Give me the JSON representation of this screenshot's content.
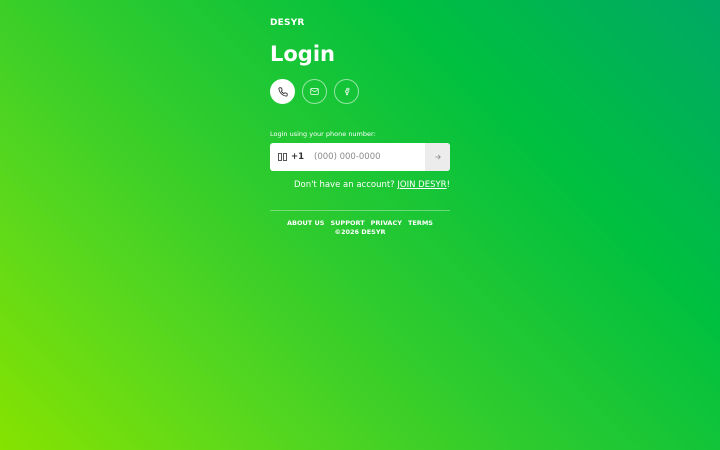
{
  "brand": {
    "logo": "DESYR"
  },
  "page": {
    "title": "Login"
  },
  "methods": [
    {
      "name": "phone",
      "icon": "phone-icon",
      "active": true
    },
    {
      "name": "email",
      "icon": "mail-icon",
      "active": false
    },
    {
      "name": "facebook",
      "icon": "facebook-icon",
      "active": false
    }
  ],
  "form": {
    "label": "Login using your phone number:",
    "country_code": "+1",
    "flag_icon": "flag-icon",
    "phone_placeholder": "(000) 000-0000",
    "phone_value": "",
    "submit_icon": "arrow-right-icon"
  },
  "signup": {
    "prompt": "Don't have an account? ",
    "link": "JOIN DESYR",
    "suffix": "!"
  },
  "footer": {
    "links": [
      "ABOUT US",
      "SUPPORT",
      "PRIVACY",
      "TERMS"
    ],
    "copyright": "©2026 DESYR"
  },
  "colors": {
    "gradient_start": "#00a865",
    "gradient_end": "#86e300",
    "text": "#ffffff"
  }
}
